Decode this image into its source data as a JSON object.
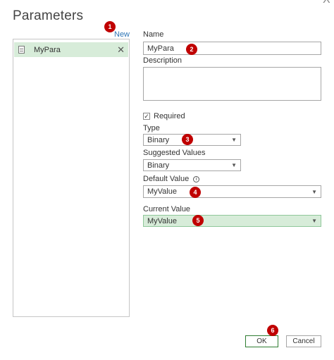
{
  "dialog": {
    "title": "Parameters",
    "close_glyph": "X"
  },
  "list": {
    "new_label": "New",
    "items": [
      {
        "label": "MyPara",
        "delete_glyph": "✕"
      }
    ]
  },
  "form": {
    "name_label": "Name",
    "name_value": "MyPara",
    "description_label": "Description",
    "description_value": "",
    "required_label": "Required",
    "required_checked": true,
    "type_label": "Type",
    "type_value": "Binary",
    "suggested_label": "Suggested Values",
    "suggested_value": "Binary",
    "default_label": "Default Value",
    "default_value": "MyValue",
    "current_label": "Current Value",
    "current_value": "MyValue"
  },
  "buttons": {
    "ok": "OK",
    "cancel": "Cancel"
  },
  "callouts": [
    "1",
    "2",
    "3",
    "4",
    "5",
    "6"
  ],
  "icons": {
    "info": "i",
    "check": "✓",
    "caret": "▼"
  },
  "colors": {
    "selection_bg": "#d7ecd9",
    "badge": "#c00000",
    "link": "#2e75b6"
  }
}
